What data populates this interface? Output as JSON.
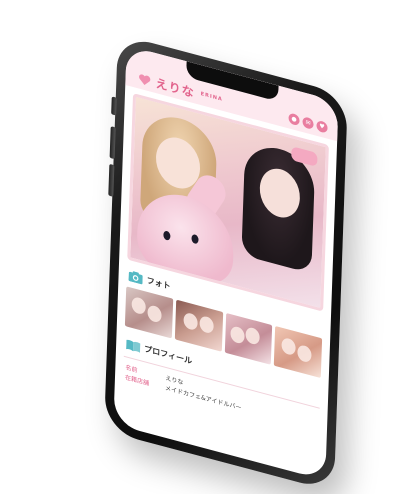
{
  "header": {
    "title": "えりな",
    "subtitle": "ERINA",
    "icons": [
      "camera-icon",
      "message-icon",
      "heart-icon"
    ]
  },
  "photo_section": {
    "label": "フォト",
    "icon": "camera-icon"
  },
  "profile_section": {
    "label": "プロフィール",
    "icon": "book-icon",
    "rows": [
      {
        "key": "名前",
        "value": "えりな"
      },
      {
        "key": "在籍店舗",
        "value": "メイドカフェ&アイドルバー"
      }
    ]
  },
  "colors": {
    "accent": "#e2648d",
    "header_bg": "#fde9ef",
    "phone_frame": "#111111"
  }
}
